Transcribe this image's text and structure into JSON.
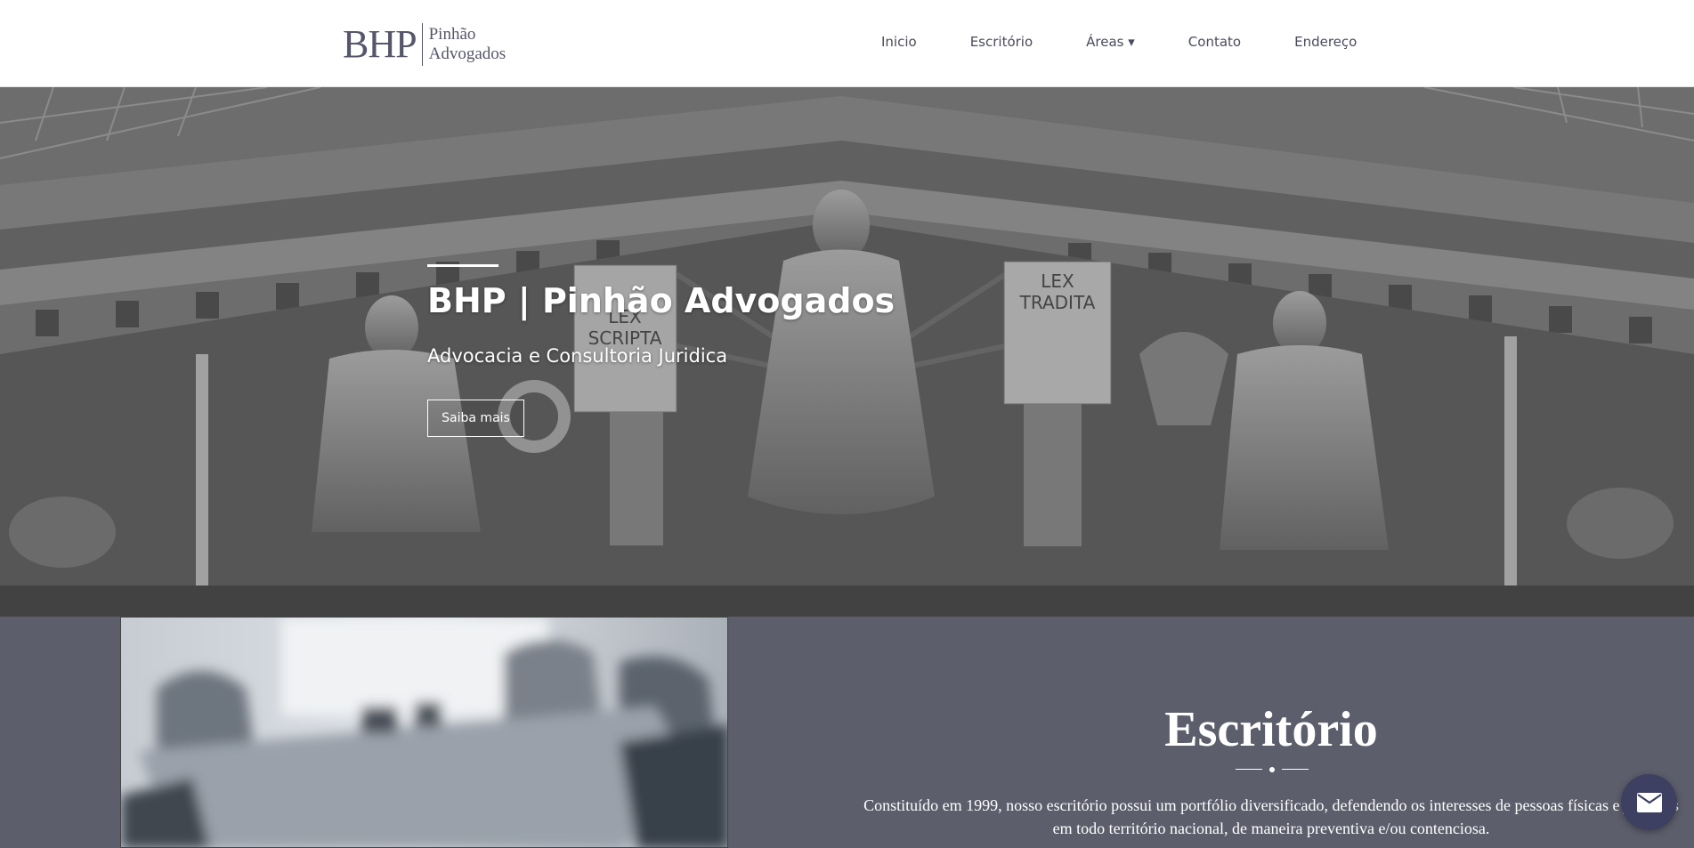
{
  "header": {
    "logo": {
      "mark": "BHP",
      "line1": "Pinhão",
      "line2": "Advogados"
    },
    "nav": [
      {
        "label": "Inicio"
      },
      {
        "label": "Escritório"
      },
      {
        "label": "Áreas ▾"
      },
      {
        "label": "Contato"
      },
      {
        "label": "Endereço"
      }
    ]
  },
  "hero": {
    "title": "BHP | Pinhão Advogados",
    "subtitle": "Advocacia e Consultoria Juridica",
    "cta_label": "Saiba mais",
    "tablet_left": "LEX SCRIPTA",
    "tablet_right": "LEX TRADITA"
  },
  "about": {
    "title": "Escritório",
    "text": "Constituído em 1999, nosso escritório possui um portfólio diversificado, defendendo os interesses de pessoas físicas e jurídicas em todo território nacional, de maneira preventiva e/ou contenciosa."
  },
  "colors": {
    "brand": "#55566a",
    "section_bg": "#5d5e6c",
    "mail_button": "#3d4060"
  },
  "icons": {
    "mail": "envelope-icon"
  }
}
